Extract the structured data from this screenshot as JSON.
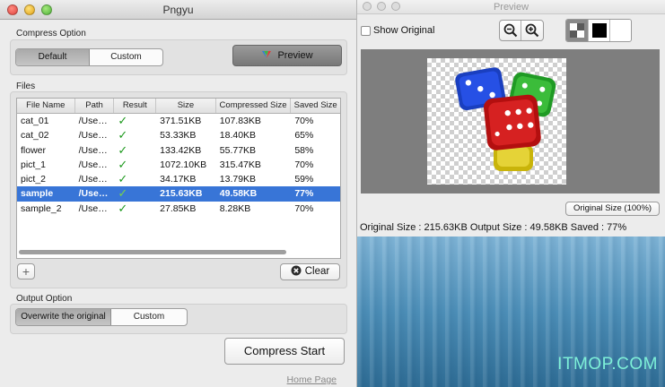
{
  "main_window": {
    "title": "Pngyu",
    "compress_option": {
      "label": "Compress Option",
      "tabs": [
        "Default",
        "Custom"
      ],
      "preview_button": "Preview"
    },
    "files": {
      "label": "Files",
      "columns": [
        "File Name",
        "Path",
        "Result",
        "Size",
        "Compressed Size",
        "Saved Size"
      ],
      "rows": [
        {
          "name": "cat_01",
          "path": "/Use…",
          "result": "✓",
          "size": "371.51KB",
          "compressed": "107.83KB",
          "saved": "70%"
        },
        {
          "name": "cat_02",
          "path": "/Use…",
          "result": "✓",
          "size": "53.33KB",
          "compressed": "18.40KB",
          "saved": "65%"
        },
        {
          "name": "flower",
          "path": "/Use…",
          "result": "✓",
          "size": "133.42KB",
          "compressed": "55.77KB",
          "saved": "58%"
        },
        {
          "name": "pict_1",
          "path": "/Use…",
          "result": "✓",
          "size": "1072.10KB",
          "compressed": "315.47KB",
          "saved": "70%"
        },
        {
          "name": "pict_2",
          "path": "/Use…",
          "result": "✓",
          "size": "34.17KB",
          "compressed": "13.79KB",
          "saved": "59%"
        },
        {
          "name": "sample",
          "path": "/Use…",
          "result": "✓",
          "size": "215.63KB",
          "compressed": "49.58KB",
          "saved": "77%"
        },
        {
          "name": "sample_2",
          "path": "/Use…",
          "result": "✓",
          "size": "27.85KB",
          "compressed": "8.28KB",
          "saved": "70%"
        }
      ],
      "selected_row": 5,
      "add_button": "+",
      "clear_button": "Clear"
    },
    "output_option": {
      "label": "Output Option",
      "tabs": [
        "Overwrite the original",
        "Custom"
      ]
    },
    "compress_start_button": "Compress Start",
    "home_page_link": "Home Page"
  },
  "preview_window": {
    "title": "Preview",
    "show_original_label": "Show Original",
    "original_size_button": "Original Size (100%)",
    "status": "Original Size : 215.63KB Output Size :  49.58KB Saved :   77%"
  },
  "watermark": "ITMOP.COM",
  "icons": {
    "zoom_out": "zoom-out-icon",
    "zoom_in": "zoom-in-icon",
    "bg_checker": "checker-background-icon",
    "bg_black": "black-background-icon",
    "bg_white": "white-background-icon",
    "clear": "clear-x-icon"
  },
  "colors": {
    "selection": "#3875d7",
    "check_green": "#1e9a1e"
  }
}
